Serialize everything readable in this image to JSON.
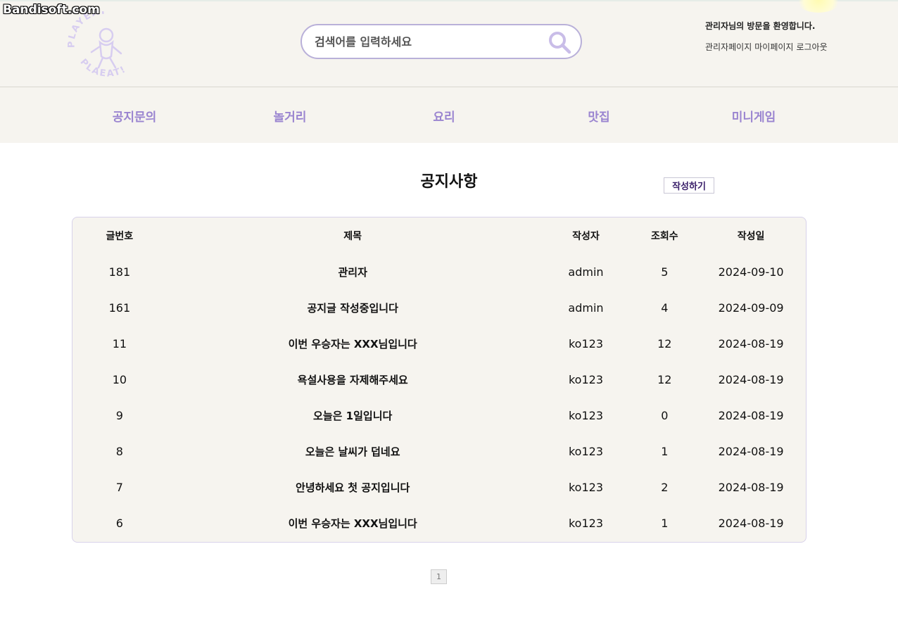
{
  "watermark": "Bandisoft.com",
  "header": {
    "logo_text_top": "PLAYEAT",
    "logo_text_bottom": "PLAEAT!",
    "search": {
      "placeholder": "검색어를 입력하세요"
    },
    "greeting": "관리자님의 방문을 환영합니다.",
    "links": [
      "관리자페이지",
      "마이페이지",
      "로그아웃"
    ]
  },
  "nav": [
    "공지문의",
    "놀거리",
    "요리",
    "맛집",
    "미니게임"
  ],
  "main": {
    "title": "공지사항",
    "write_label": "작성하기",
    "columns": [
      "글번호",
      "제목",
      "작성자",
      "조회수",
      "작성일"
    ],
    "rows": [
      {
        "no": "181",
        "title": "관리자",
        "author": "admin",
        "views": "5",
        "date": "2024-09-10"
      },
      {
        "no": "161",
        "title": "공지글 작성중입니다",
        "author": "admin",
        "views": "4",
        "date": "2024-09-09"
      },
      {
        "no": "11",
        "title": "이번 우승자는 XXX님입니다",
        "author": "ko123",
        "views": "12",
        "date": "2024-08-19"
      },
      {
        "no": "10",
        "title": "욕설사용을 자제해주세요",
        "author": "ko123",
        "views": "12",
        "date": "2024-08-19"
      },
      {
        "no": "9",
        "title": "오늘은 1일입니다",
        "author": "ko123",
        "views": "0",
        "date": "2024-08-19"
      },
      {
        "no": "8",
        "title": "오늘은 날씨가 덥네요",
        "author": "ko123",
        "views": "1",
        "date": "2024-08-19"
      },
      {
        "no": "7",
        "title": "안녕하세요 첫 공지입니다",
        "author": "ko123",
        "views": "2",
        "date": "2024-08-19"
      },
      {
        "no": "6",
        "title": "이번 우승자는 XXX님입니다",
        "author": "ko123",
        "views": "1",
        "date": "2024-08-19"
      }
    ],
    "pages": [
      "1"
    ]
  },
  "colors": {
    "accent": "#9a84d0",
    "header_bg": "#f6f4ef",
    "board_bg": "#f6f4ef",
    "border": "#d8d2ea"
  }
}
